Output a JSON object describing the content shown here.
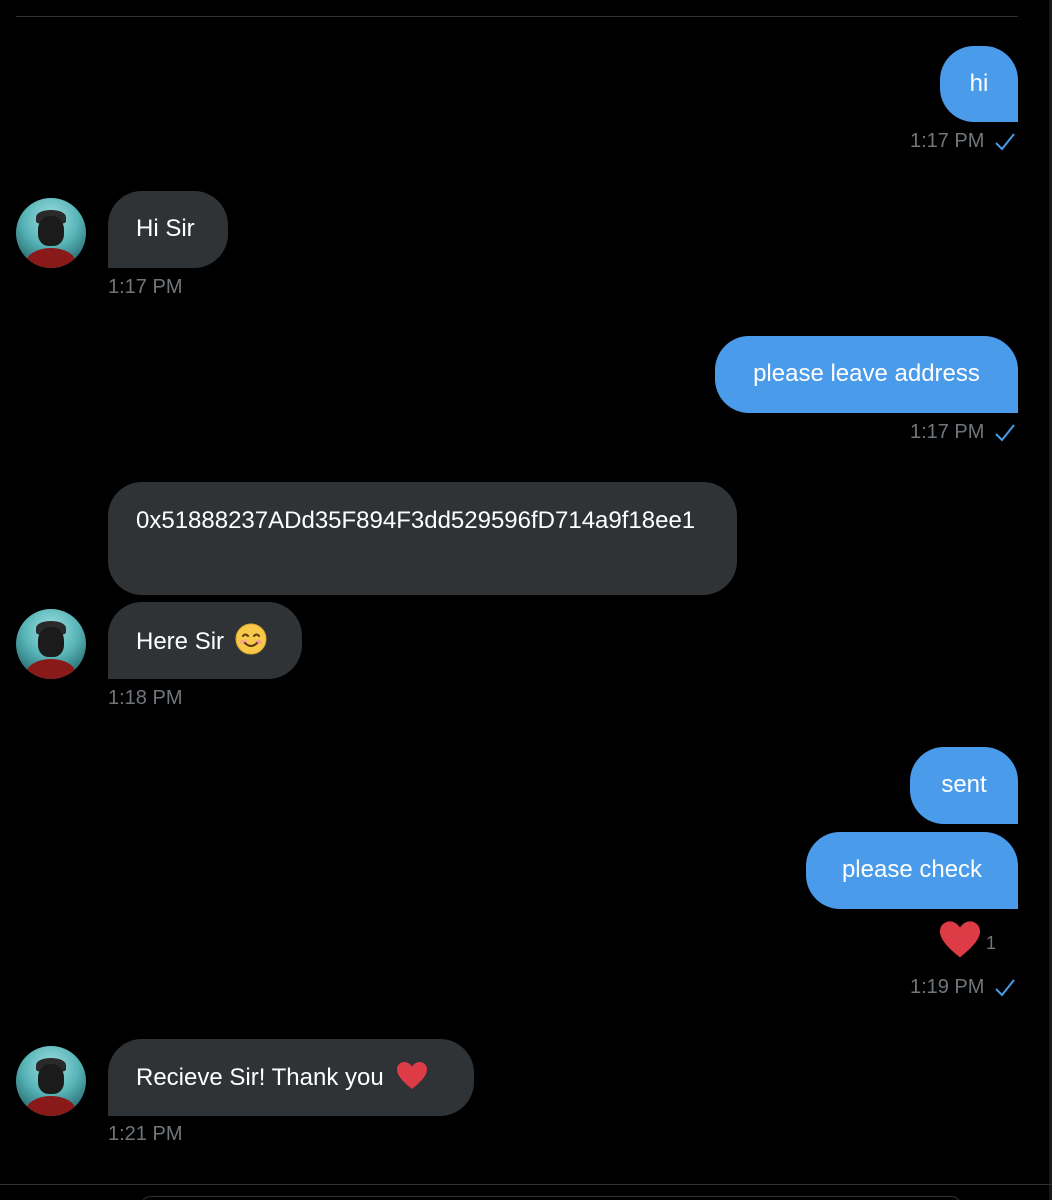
{
  "conversation": {
    "messages": [
      {
        "direction": "outgoing",
        "text": "hi",
        "time": "1:17 PM",
        "status": "sent-check"
      },
      {
        "direction": "incoming",
        "text": "Hi Sir",
        "time": "1:17 PM"
      },
      {
        "direction": "outgoing",
        "text": "please leave address",
        "time": "1:17 PM",
        "status": "sent-check"
      },
      {
        "direction": "incoming",
        "text": "0x51888237ADd35F894F3dd529596fD714a9f18ee1"
      },
      {
        "direction": "incoming",
        "text": "Here Sir",
        "emoji": "smiling-face-with-smiling-eyes",
        "time": "1:18 PM"
      },
      {
        "direction": "outgoing",
        "text": "sent"
      },
      {
        "direction": "outgoing",
        "text": "please check",
        "reaction": {
          "emoji": "red-heart",
          "count": "1"
        },
        "time": "1:19 PM",
        "status": "sent-check"
      },
      {
        "direction": "incoming",
        "text": "Recieve Sir! Thank you",
        "emoji": "red-heart",
        "time": "1:21 PM"
      }
    ]
  },
  "colors": {
    "background": "#000000",
    "outgoing_bubble": "#4a9bea",
    "incoming_bubble": "#2f3336",
    "timestamp": "#71767b",
    "check": "#4a9bea",
    "heart": "#e0245e"
  },
  "icons": {
    "check": "check-icon",
    "avatar": "contact-avatar",
    "heart": "heart-icon",
    "smile": "smile-emoji-icon"
  }
}
